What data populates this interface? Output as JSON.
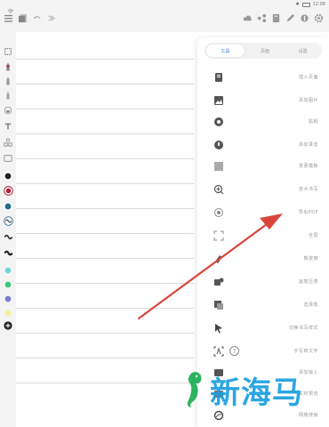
{
  "status_bar": {
    "time": "12:08"
  },
  "panel": {
    "tabs": [
      {
        "label": "工具",
        "active": true
      },
      {
        "label": "页面",
        "active": false
      },
      {
        "label": "设置",
        "active": false
      }
    ],
    "items": [
      {
        "label": "插入页面",
        "icon": "page-icon"
      },
      {
        "label": "添加图片",
        "icon": "image-icon"
      },
      {
        "label": "贴纸",
        "icon": "sticker-icon"
      },
      {
        "label": "添加录音",
        "icon": "mic-icon"
      },
      {
        "label": "变更模板",
        "icon": "template-icon"
      },
      {
        "label": "放大书写",
        "icon": "zoom-write-icon"
      },
      {
        "label": "导出PDF",
        "icon": "export-pdf-icon"
      },
      {
        "label": "全屏",
        "icon": "fullscreen-icon"
      },
      {
        "label": "橡皮擦",
        "icon": "eraser-icon"
      },
      {
        "label": "画笔压感",
        "icon": "pen-pressure-icon"
      },
      {
        "label": "选择笔",
        "icon": "select-pen-icon"
      },
      {
        "label": "切换书写样式",
        "icon": "cursor-icon"
      },
      {
        "label": "手写转文字",
        "icon": "ocr-icon"
      },
      {
        "label": "添加输入",
        "icon": "input-icon"
      },
      {
        "label": "实时预览",
        "icon": "preview-icon"
      },
      {
        "label": "网格搜索",
        "icon": "search-icon"
      }
    ]
  },
  "colors": {
    "accent": "#2a72d8",
    "arrow": "#d9453c",
    "watermark": "#1a9fe0"
  },
  "watermark": {
    "text": "新海马"
  }
}
